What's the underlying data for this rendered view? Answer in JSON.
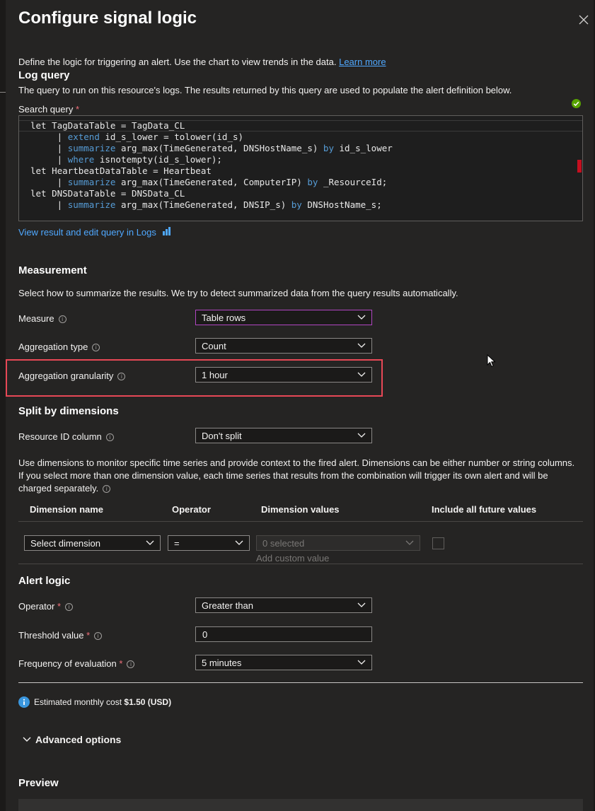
{
  "title": "Configure signal logic",
  "description": "Define the logic for triggering an alert. Use the chart to view trends in the data.",
  "learn_more": "Learn more",
  "log_query": {
    "heading": "Log query",
    "desc": "The query to run on this resource's logs. The results returned by this query are used to populate the alert definition below.",
    "search_label": "Search query",
    "required": "*",
    "view_link": "View result and edit query in Logs"
  },
  "code_lines": [
    [
      {
        "t": "let TagDataTable = TagData_CL",
        "k": false
      }
    ],
    [
      {
        "t": "     | ",
        "k": false
      },
      {
        "t": "extend",
        "k": true
      },
      {
        "t": " id_s_lower = tolower(id_s)",
        "k": false
      }
    ],
    [
      {
        "t": "     | ",
        "k": false
      },
      {
        "t": "summarize",
        "k": true
      },
      {
        "t": " arg_max(TimeGenerated, DNSHostName_s) ",
        "k": false
      },
      {
        "t": "by",
        "k": true
      },
      {
        "t": " id_s_lower",
        "k": false
      }
    ],
    [
      {
        "t": "     | ",
        "k": false
      },
      {
        "t": "where",
        "k": true
      },
      {
        "t": " isnotempty(id_s_lower);",
        "k": false
      }
    ],
    [
      {
        "t": "let HeartbeatDataTable = Heartbeat",
        "k": false
      }
    ],
    [
      {
        "t": "     | ",
        "k": false
      },
      {
        "t": "summarize",
        "k": true
      },
      {
        "t": " arg_max(TimeGenerated, ComputerIP) ",
        "k": false
      },
      {
        "t": "by",
        "k": true
      },
      {
        "t": " _ResourceId;",
        "k": false
      }
    ],
    [
      {
        "t": "let DNSDataTable = DNSData_CL",
        "k": false
      }
    ],
    [
      {
        "t": "     | ",
        "k": false
      },
      {
        "t": "summarize",
        "k": true
      },
      {
        "t": " arg_max(TimeGenerated, DNSIP_s) ",
        "k": false
      },
      {
        "t": "by",
        "k": true
      },
      {
        "t": " DNSHostName_s;",
        "k": false
      }
    ]
  ],
  "measurement": {
    "heading": "Measurement",
    "desc": "Select how to summarize the results. We try to detect summarized data from the query results automatically.",
    "measure_label": "Measure",
    "measure_value": "Table rows",
    "agg_type_label": "Aggregation type",
    "agg_type_value": "Count",
    "agg_gran_label": "Aggregation granularity",
    "agg_gran_value": "1 hour"
  },
  "split": {
    "heading": "Split by dimensions",
    "resource_label": "Resource ID column",
    "resource_value": "Don't split",
    "desc1": "Use dimensions to monitor specific time series and provide context to the fired alert. Dimensions can be either number or string columns.",
    "desc2": "If you select more than one dimension value, each time series that results from the combination will trigger its own alert and will be",
    "desc3": "charged separately.",
    "col_name": "Dimension name",
    "col_operator": "Operator",
    "col_values": "Dimension values",
    "col_future": "Include all future values",
    "dim_select": "Select dimension",
    "op_value": "=",
    "values_value": "0 selected",
    "add_custom": "Add custom value"
  },
  "alert_logic": {
    "heading": "Alert logic",
    "operator_label": "Operator",
    "operator_value": "Greater than",
    "threshold_label": "Threshold value",
    "threshold_value": "0",
    "freq_label": "Frequency of evaluation",
    "freq_value": "5 minutes"
  },
  "cost_label": "Estimated monthly cost",
  "cost_value": "$1.50 (USD)",
  "advanced": "Advanced options",
  "preview": "Preview",
  "info_glyph": "i"
}
